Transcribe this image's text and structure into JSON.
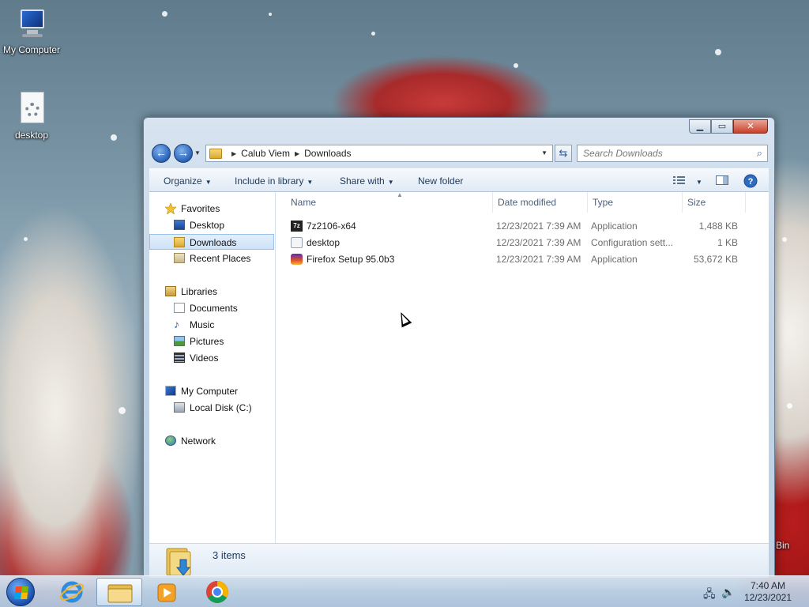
{
  "desktop": {
    "icons": [
      {
        "label": "My Computer",
        "icon": "computer-icon"
      },
      {
        "label": "desktop",
        "icon": "config-file-icon"
      }
    ],
    "recycle_bin_label": "Bin"
  },
  "window": {
    "address": {
      "segments": [
        "Calub Viem",
        "Downloads"
      ]
    },
    "search": {
      "placeholder": "Search Downloads"
    },
    "toolbar": {
      "organize": "Organize",
      "include_in_library": "Include in library",
      "share_with": "Share with",
      "new_folder": "New folder"
    },
    "nav": {
      "favorites": "Favorites",
      "desktop": "Desktop",
      "downloads": "Downloads",
      "recent_places": "Recent Places",
      "libraries": "Libraries",
      "documents": "Documents",
      "music": "Music",
      "pictures": "Pictures",
      "videos": "Videos",
      "my_computer": "My Computer",
      "local_disk": "Local Disk (C:)",
      "network": "Network",
      "selected": "Downloads"
    },
    "columns": {
      "name": "Name",
      "date_modified": "Date modified",
      "type": "Type",
      "size": "Size"
    },
    "files": [
      {
        "name": "7z2106-x64",
        "date": "12/23/2021 7:39 AM",
        "type": "Application",
        "size": "1,488 KB",
        "icon": "7zip-icon"
      },
      {
        "name": "desktop",
        "date": "12/23/2021 7:39 AM",
        "type": "Configuration sett...",
        "size": "1 KB",
        "icon": "config-file-icon"
      },
      {
        "name": "Firefox Setup 95.0b3",
        "date": "12/23/2021 7:39 AM",
        "type": "Application",
        "size": "53,672 KB",
        "icon": "firefox-icon"
      }
    ],
    "status": {
      "item_count": "3 items"
    }
  },
  "taskbar": {
    "apps": [
      {
        "name": "Internet Explorer",
        "icon": "internet-explorer-icon"
      },
      {
        "name": "Windows Explorer",
        "icon": "folder-icon",
        "active": true
      },
      {
        "name": "Windows Media Player",
        "icon": "media-player-icon"
      },
      {
        "name": "Google Chrome",
        "icon": "chrome-icon"
      }
    ],
    "clock": {
      "time": "7:40 AM",
      "date": "12/23/2021"
    }
  },
  "colors": {
    "accent": "#2a62b7",
    "selection": "#cde2f7",
    "close_button": "#c9402a"
  }
}
